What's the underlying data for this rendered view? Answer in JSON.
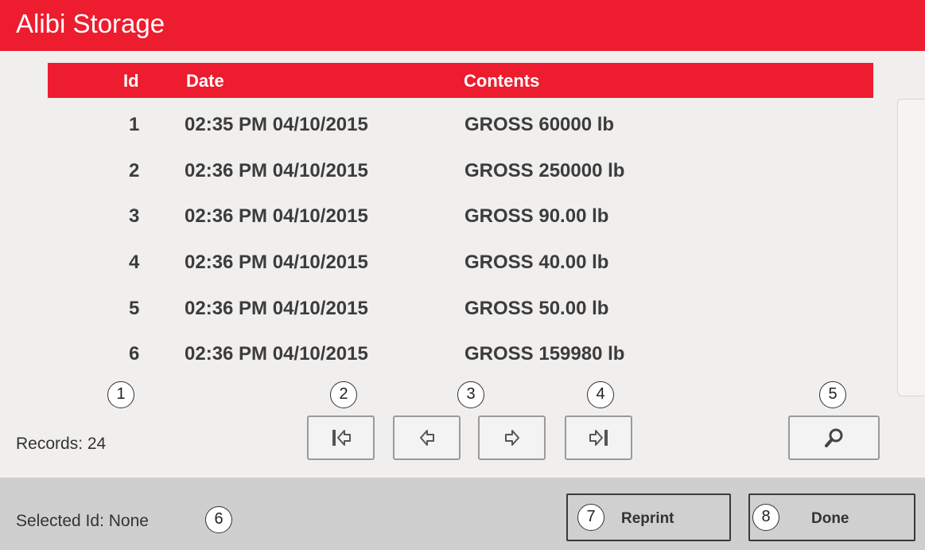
{
  "app": {
    "title": "Alibi Storage"
  },
  "table": {
    "headers": {
      "id": "Id",
      "date": "Date",
      "contents": "Contents"
    },
    "rows": [
      {
        "id": "1",
        "date": "02:35 PM 04/10/2015",
        "contents": "GROSS 60000 lb"
      },
      {
        "id": "2",
        "date": "02:36 PM 04/10/2015",
        "contents": "GROSS 250000 lb"
      },
      {
        "id": "3",
        "date": "02:36 PM 04/10/2015",
        "contents": "GROSS 90.00 lb"
      },
      {
        "id": "4",
        "date": "02:36 PM 04/10/2015",
        "contents": "GROSS 40.00 lb"
      },
      {
        "id": "5",
        "date": "02:36 PM 04/10/2015",
        "contents": "GROSS 50.00 lb"
      },
      {
        "id": "6",
        "date": "02:36 PM 04/10/2015",
        "contents": "GROSS 159980 lb"
      }
    ]
  },
  "records": {
    "label": "Records: 24"
  },
  "navigation": {
    "first_icon": "first-page-icon",
    "prev_icon": "previous-page-icon",
    "next_icon": "next-page-icon",
    "last_icon": "last-page-icon",
    "search_icon": "search-icon"
  },
  "footer": {
    "selected_label": "Selected Id:",
    "selected_value": "None",
    "reprint_label": "Reprint",
    "done_label": "Done"
  },
  "callouts": {
    "c1": "1",
    "c2": "2",
    "c3": "3",
    "c4": "4",
    "c5": "5",
    "c6": "6",
    "c7": "7",
    "c8": "8"
  },
  "colors": {
    "accent": "#ed1c2e",
    "footer": "#cfcfcf",
    "background": "#f0efee"
  }
}
